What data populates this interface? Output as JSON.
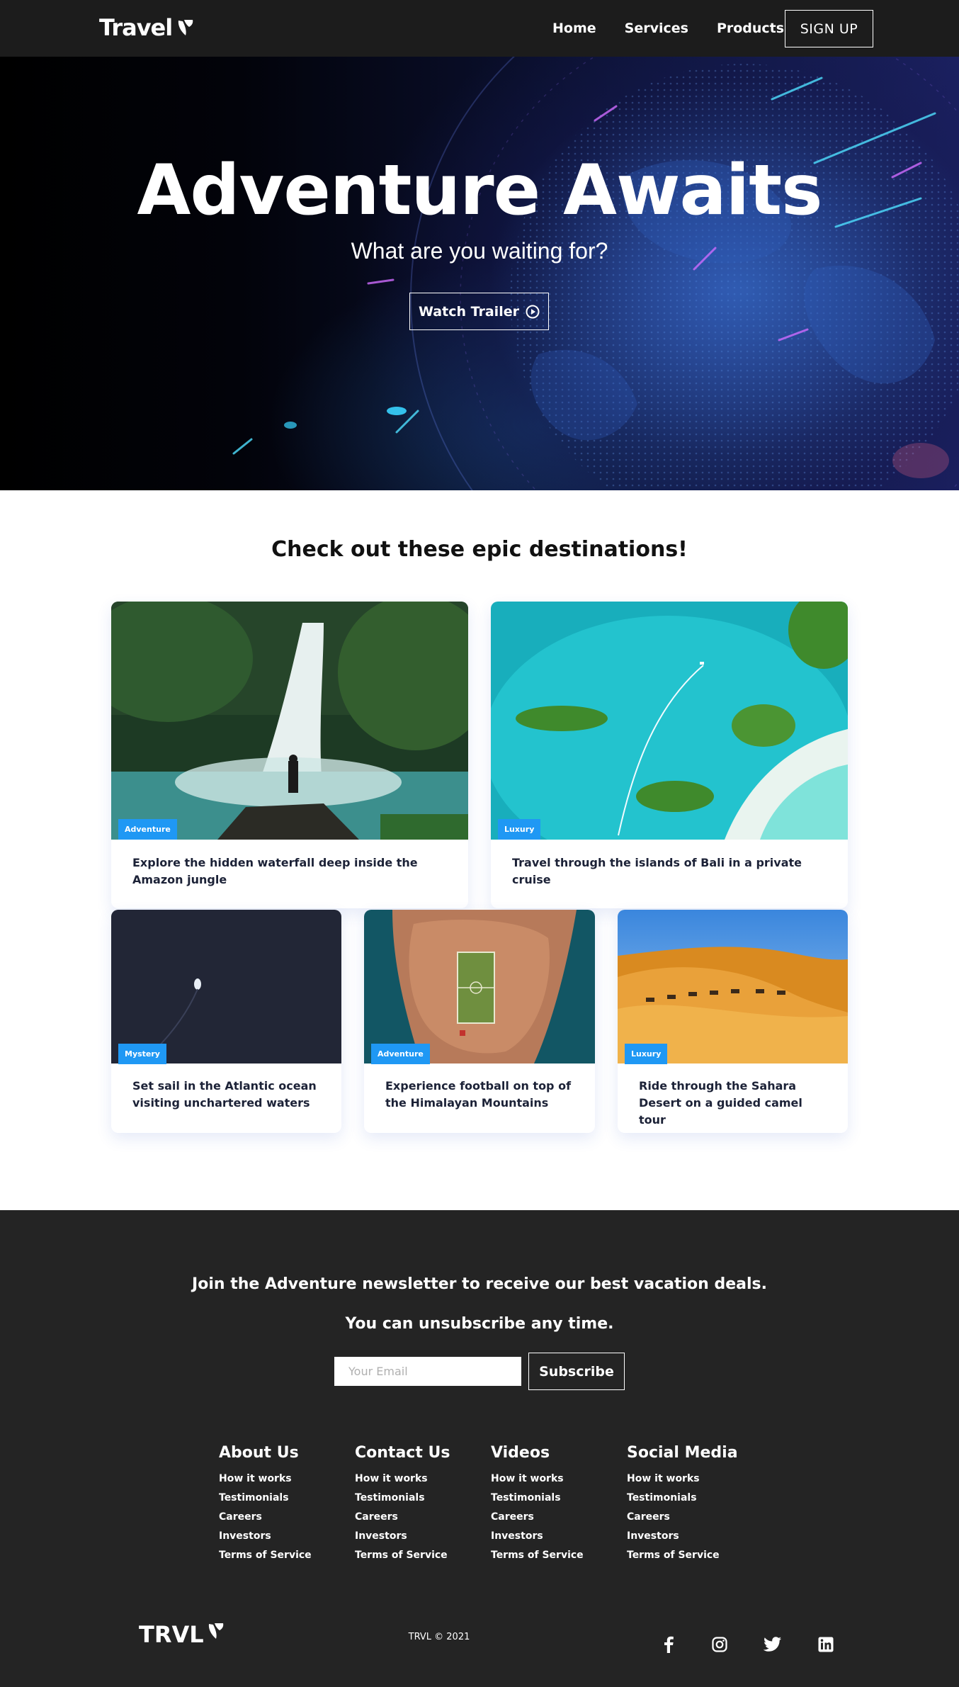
{
  "navbar": {
    "logo": "Travel",
    "links": [
      "Home",
      "Services",
      "Products"
    ],
    "signup": "SIGN UP"
  },
  "hero": {
    "title": "Adventure Awaits",
    "subtitle": "What are you waiting for?",
    "watch_trailer": "Watch Trailer"
  },
  "destinations": {
    "title": "Check out these epic destinations!",
    "cards": [
      {
        "tag": "Adventure",
        "text": "Explore the hidden waterfall deep inside the Amazon jungle"
      },
      {
        "tag": "Luxury",
        "text": "Travel through the islands of Bali in a private cruise"
      },
      {
        "tag": "Mystery",
        "text": "Set sail in the Atlantic ocean visiting unchartered waters"
      },
      {
        "tag": "Adventure",
        "text": "Experience football on top of the Himalayan Mountains"
      },
      {
        "tag": "Luxury",
        "text": "Ride through the Sahara Desert on a guided camel tour"
      }
    ]
  },
  "footer": {
    "newsletter_line1": "Join the Adventure newsletter to receive our best vacation deals.",
    "newsletter_line2": "You can unsubscribe any time.",
    "email_placeholder": "Your Email",
    "subscribe": "Subscribe",
    "columns": [
      {
        "title": "About Us",
        "links": [
          "How it works",
          "Testimonials",
          "Careers",
          "Investors",
          "Terms of Service"
        ]
      },
      {
        "title": "Contact Us",
        "links": [
          "How it works",
          "Testimonials",
          "Careers",
          "Investors",
          "Terms of Service"
        ]
      },
      {
        "title": "Videos",
        "links": [
          "How it works",
          "Testimonials",
          "Careers",
          "Investors",
          "Terms of Service"
        ]
      },
      {
        "title": "Social Media",
        "links": [
          "How it works",
          "Testimonials",
          "Careers",
          "Investors",
          "Terms of Service"
        ]
      }
    ],
    "logo": "TRVL",
    "copyright": "TRVL © 2021",
    "social_icons": [
      "facebook-icon",
      "instagram-icon",
      "twitter-icon",
      "linkedin-icon"
    ]
  },
  "colors": {
    "navbar_bg": "#1c1c1c",
    "footer_bg": "#242424",
    "tag_blue": "#1f98f4",
    "card_text": "#1c2237"
  }
}
